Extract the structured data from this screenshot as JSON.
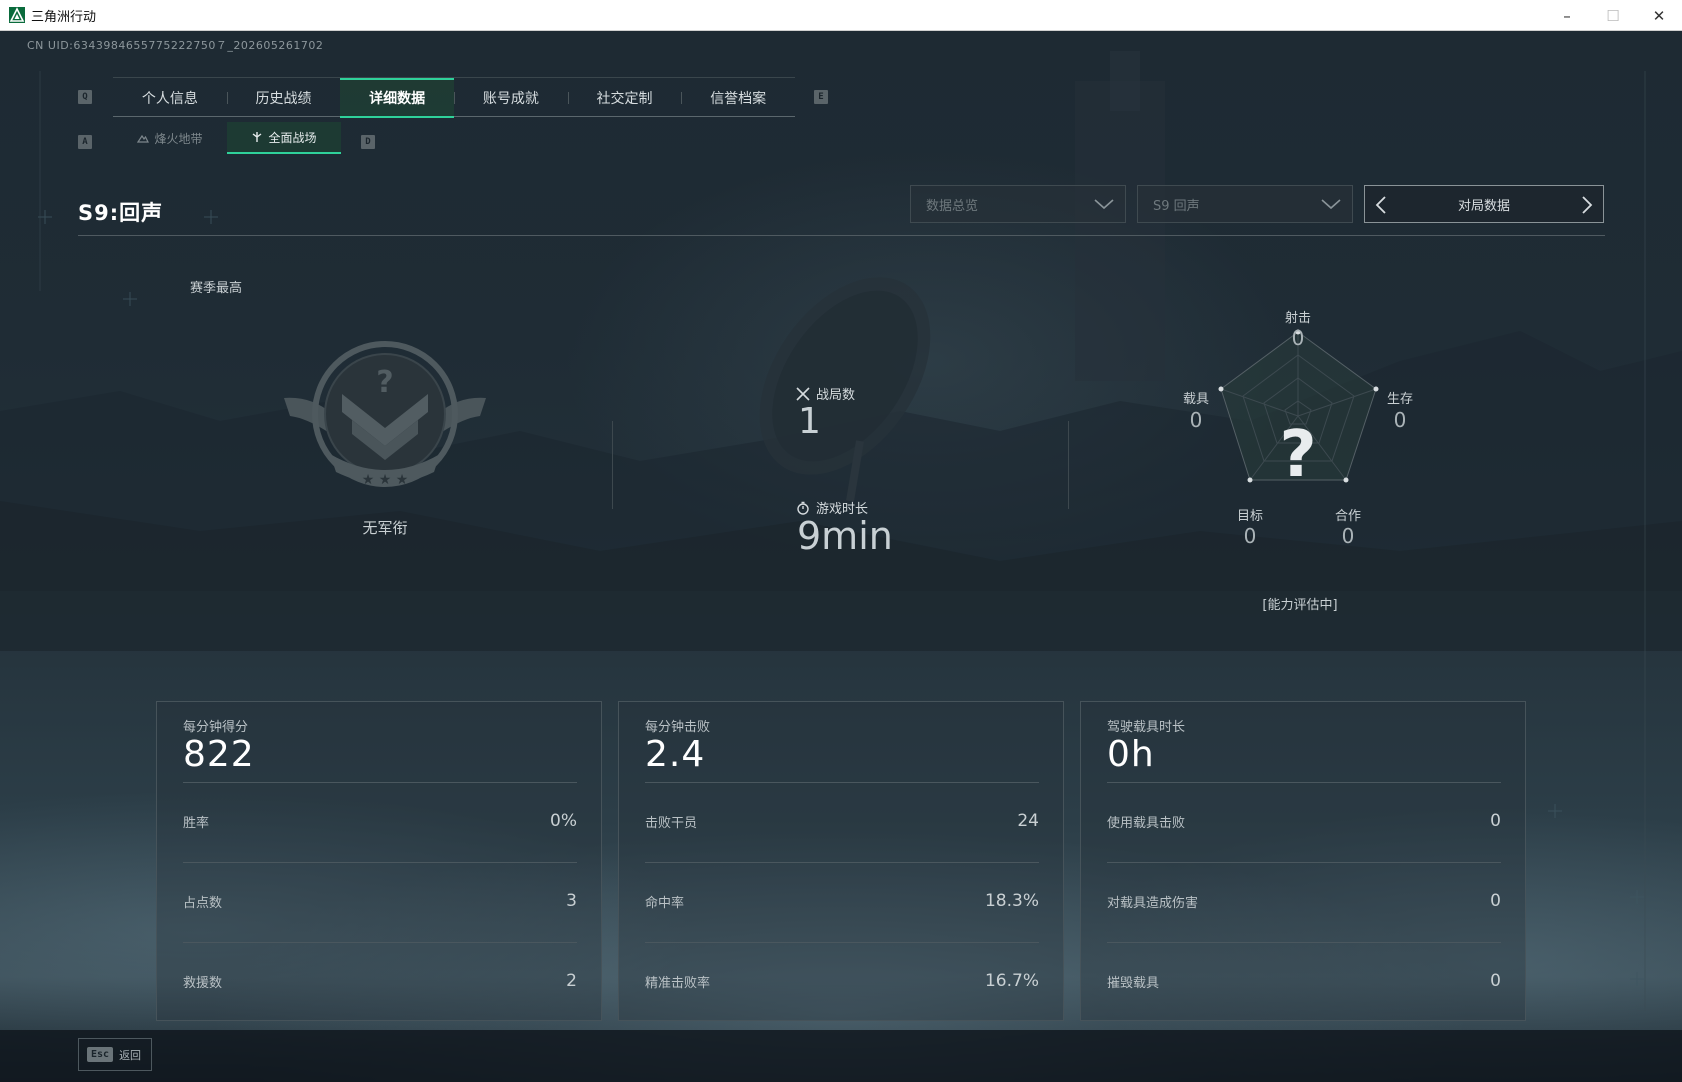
{
  "window": {
    "title": "三角洲行动",
    "controls": {
      "minimize": "–",
      "maximize": "☐",
      "close": "✕"
    }
  },
  "uid": "CN UID:6343984655775222750７_202605261702",
  "tabs": {
    "prev_key": "Q",
    "next_key": "E",
    "items": [
      {
        "label": "个人信息",
        "active": false
      },
      {
        "label": "历史战绩",
        "active": false
      },
      {
        "label": "详细数据",
        "active": true
      },
      {
        "label": "账号成就",
        "active": false
      },
      {
        "label": "社交定制",
        "active": false
      },
      {
        "label": "信誉档案",
        "active": false
      }
    ]
  },
  "subtabs": {
    "prev_key": "A",
    "next_key": "D",
    "items": [
      {
        "label": "烽火地带",
        "icon": "mountain-icon",
        "active": false
      },
      {
        "label": "全面战场",
        "icon": "battlefield-icon",
        "active": true
      }
    ]
  },
  "section": {
    "title": "S9:回声"
  },
  "filters": {
    "data_type": "数据总览",
    "season": "S9 回声",
    "mode": "对局数据"
  },
  "season_best": {
    "label": "赛季最高",
    "rank_name": "无军衔",
    "icon": "rank-emblem-unknown"
  },
  "match_stats": {
    "matches_label": "战局数",
    "matches_value": "1",
    "playtime_label": "游戏时长",
    "playtime_value": "9min"
  },
  "radar": {
    "center_symbol": "?",
    "status": "[能力评估中]",
    "axes": [
      {
        "label": "射击",
        "value": "0"
      },
      {
        "label": "生存",
        "value": "0"
      },
      {
        "label": "合作",
        "value": "0"
      },
      {
        "label": "目标",
        "value": "0"
      },
      {
        "label": "载具",
        "value": "0"
      }
    ]
  },
  "cards": [
    {
      "title": "每分钟得分",
      "value": "822",
      "rows": [
        {
          "label": "胜率",
          "value": "0%"
        },
        {
          "label": "占点数",
          "value": "3"
        },
        {
          "label": "救援数",
          "value": "2"
        }
      ]
    },
    {
      "title": "每分钟击败",
      "value": "2.4",
      "rows": [
        {
          "label": "击败干员",
          "value": "24"
        },
        {
          "label": "命中率",
          "value": "18.3%"
        },
        {
          "label": "精准击败率",
          "value": "16.7%"
        }
      ]
    },
    {
      "title": "驾驶载具时长",
      "value": "0h",
      "rows": [
        {
          "label": "使用载具击败",
          "value": "0"
        },
        {
          "label": "对载具造成伤害",
          "value": "0"
        },
        {
          "label": "摧毁载具",
          "value": "0"
        }
      ]
    }
  ],
  "footer": {
    "esc_key": "Esc",
    "back_label": "返回"
  },
  "colors": {
    "accent": "#2fd19a",
    "background": "#1e2a33",
    "card_border": "#46535a"
  }
}
